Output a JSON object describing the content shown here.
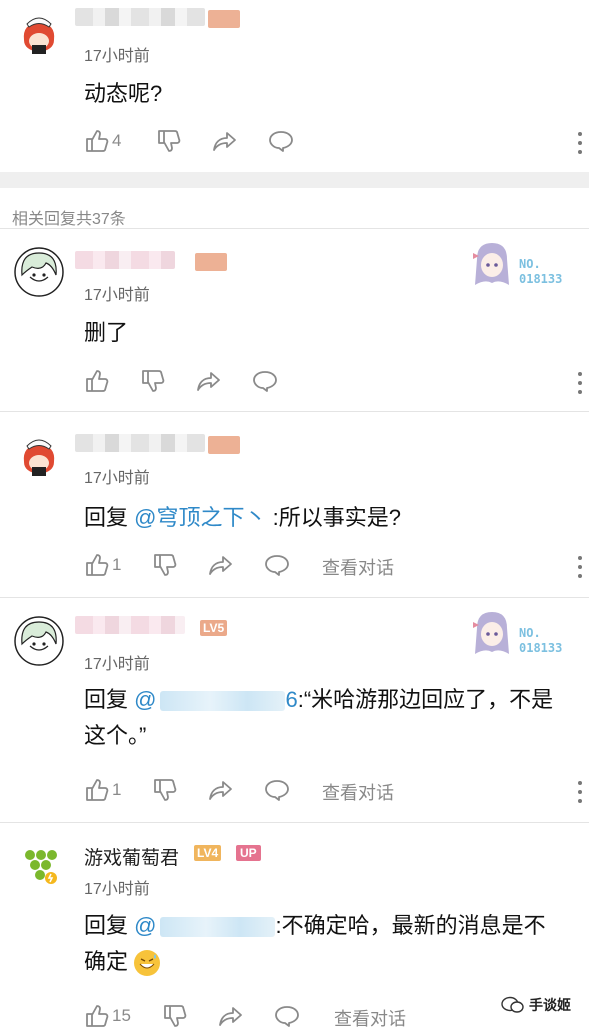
{
  "comments": [
    {
      "time": "17小时前",
      "text": "动态呢?",
      "like_count": "4"
    },
    {
      "time": "17小时前",
      "text": "删了",
      "badge_no": "NO.",
      "badge_num": "018133"
    },
    {
      "time": "17小时前",
      "reply_prefix": "回复",
      "mention": "@穹顶之下丶",
      "text": ":所以事实是?",
      "like_count": "1",
      "view_dialog": "查看对话"
    },
    {
      "time": "17小时前",
      "reply_prefix": "回复",
      "mention": "@",
      "mention_tail": "6",
      "text_line1": ":“米哈游那边回应了，不是",
      "text_line2": "这个。”",
      "like_count": "1",
      "view_dialog": "查看对话",
      "badge_no": "NO.",
      "badge_num": "018133",
      "level_text": "LV5"
    },
    {
      "username": "游戏葡萄君",
      "level": "LV4",
      "up_tag": "UP",
      "time": "17小时前",
      "reply_prefix": "回复",
      "mention": "@",
      "text_line1": ":不确定哈，最新的消息是不",
      "text_line2": "确定",
      "like_count": "15",
      "view_dialog": "查看对话"
    }
  ],
  "section": {
    "related_replies": "相关回复共37条"
  },
  "watermark": {
    "text": "手谈姬"
  },
  "icons": {
    "like": "thumbs-up-icon",
    "dislike": "thumbs-down-icon",
    "share": "share-icon",
    "reply": "comment-bubble-icon",
    "more": "more-vertical-icon"
  },
  "colors": {
    "mention": "#2f89c8",
    "divider_band": "#efefef",
    "up_tag": "#e5738f",
    "level": "#f0b55d"
  }
}
